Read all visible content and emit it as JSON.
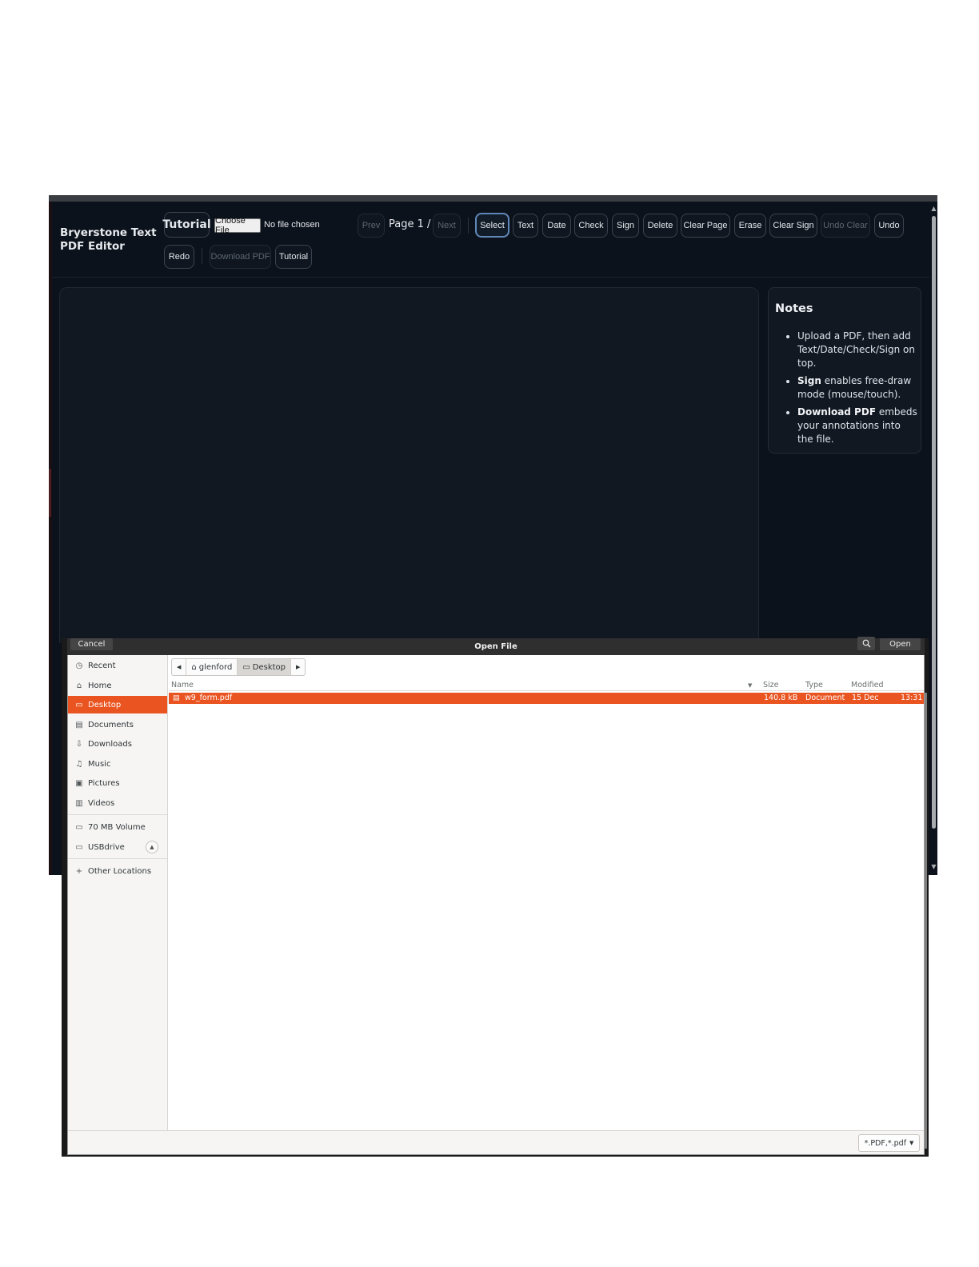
{
  "app": {
    "title": "Bryerstone Text PDF Editor",
    "tutorial_big": "Tutorial",
    "choose_file": "Choose File",
    "no_file": "No file chosen",
    "prev": "Prev",
    "page_indicator": "Page 1 / 0",
    "next": "Next",
    "tools": {
      "select": "Select",
      "text": "Text",
      "date": "Date",
      "check": "Check",
      "sign": "Sign",
      "delete": "Delete",
      "clear_page": "Clear Page",
      "erase": "Erase",
      "clear_sign": "Clear Sign",
      "undo_clear": "Undo Clear",
      "undo": "Undo",
      "redo": "Redo",
      "download_pdf": "Download PDF",
      "tutorial": "Tutorial"
    },
    "notes": {
      "title": "Notes",
      "item1": "Upload a PDF, then add Text/Date/Check/Sign on top.",
      "item2_bold": "Sign",
      "item2_rest": " enables free-draw mode (mouse/touch).",
      "item3_bold": "Download PDF",
      "item3_rest": " embeds your annotations into the file."
    }
  },
  "dialog": {
    "title": "Open File",
    "cancel": "Cancel",
    "open": "Open",
    "places": [
      {
        "label": "Recent",
        "icon": "clock-icon"
      },
      {
        "label": "Home",
        "icon": "home-icon"
      },
      {
        "label": "Desktop",
        "icon": "desktop-icon",
        "selected": true
      },
      {
        "label": "Documents",
        "icon": "document-icon"
      },
      {
        "label": "Downloads",
        "icon": "download-icon"
      },
      {
        "label": "Music",
        "icon": "music-icon"
      },
      {
        "label": "Pictures",
        "icon": "picture-icon"
      },
      {
        "label": "Videos",
        "icon": "film-icon"
      },
      {
        "label": "70 MB Volume",
        "icon": "drive-icon"
      },
      {
        "label": "USBdrive",
        "icon": "drive-icon"
      },
      {
        "label": "Other Locations",
        "icon": "plus-icon"
      }
    ],
    "path": {
      "home": "glenford",
      "current": "Desktop"
    },
    "columns": {
      "name": "Name",
      "size": "Size",
      "type": "Type",
      "modified": "Modified"
    },
    "files": [
      {
        "name": "w9_form.pdf",
        "size": "140.8 kB",
        "type": "Document",
        "date": "15 Dec",
        "time": "13:31"
      }
    ],
    "filter": "*.PDF,*.pdf"
  }
}
